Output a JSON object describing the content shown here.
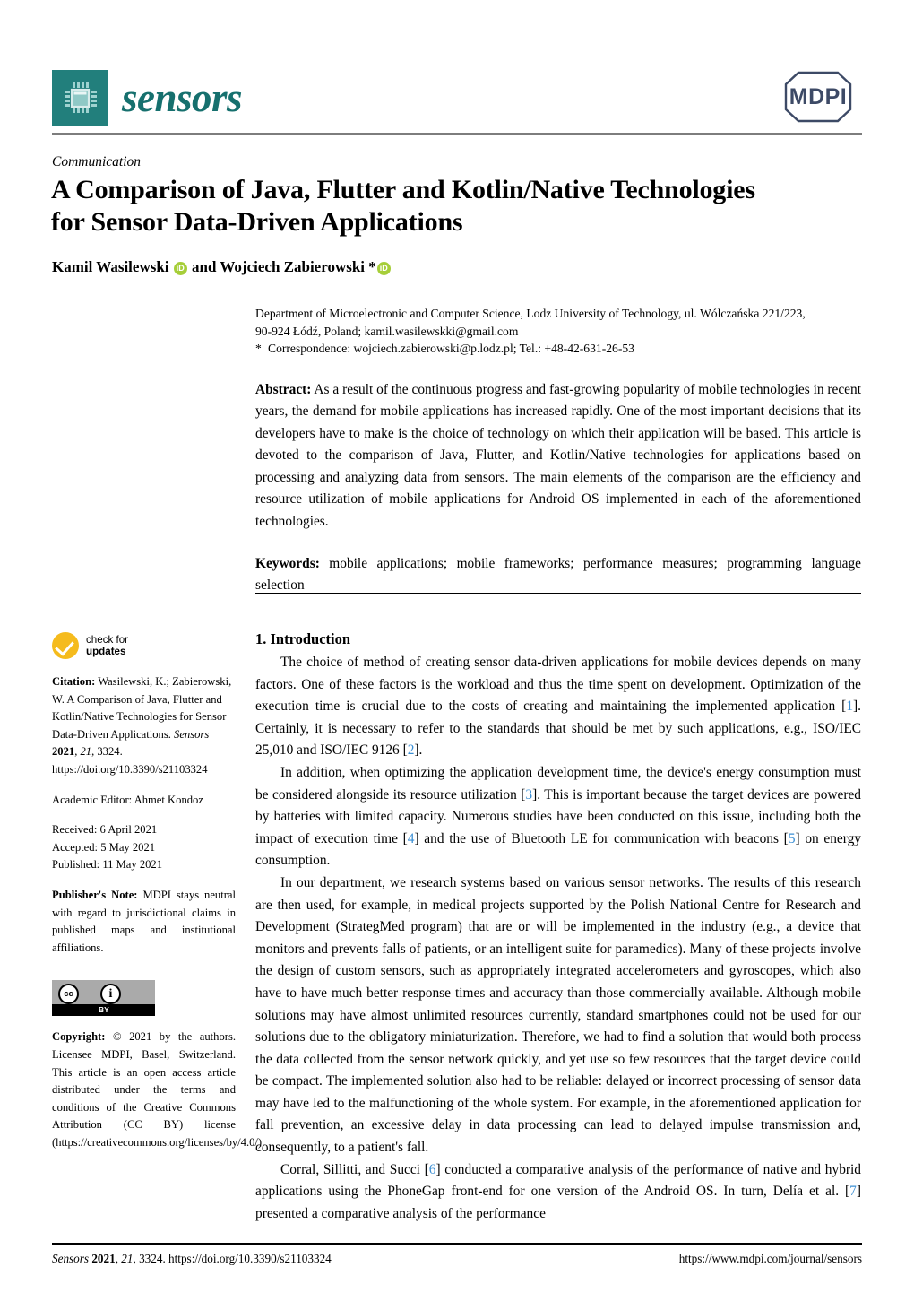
{
  "header": {
    "journal_name": "sensors",
    "logo_icon": "microchip-icon",
    "publisher_logo_text": "MDPI",
    "logo_bg_color": "#227f7c",
    "journal_text_color": "#16706e",
    "mdpi_color": "#3d4a66"
  },
  "article": {
    "type_label": "Communication",
    "title_line1": "A Comparison of Java, Flutter and Kotlin/Native Technologies",
    "title_line2": "for Sensor Data-Driven Applications",
    "author_pre": "Kamil Wasilewski",
    "author_mid": " and Wojciech Zabierowski *",
    "orcid_glyph": "iD",
    "orcid_color": "#a6ce39"
  },
  "affiliation": {
    "line1": "Department of Microelectronic and Computer Science, Lodz University of Technology, ul. Wólczańska 221/223,",
    "line2": "90-924 Łódź, Poland; kamil.wasilewskki@gmail.com",
    "star": "*",
    "correspondence": "Correspondence: wojciech.zabierowski@p.lodz.pl; Tel.: +48-42-631-26-53"
  },
  "abstract": {
    "label": "Abstract:",
    "text": " As a result of the continuous progress and fast-growing popularity of mobile technologies in recent years, the demand for mobile applications has increased rapidly. One of the most important decisions that its developers have to make is the choice of technology on which their application will be based. This article is devoted to the comparison of Java, Flutter, and Kotlin/Native technologies for applications based on processing and analyzing data from sensors. The main elements of the comparison are the efficiency and resource utilization of mobile applications for Android OS implemented in each of the aforementioned technologies."
  },
  "keywords": {
    "label": "Keywords:",
    "text": " mobile applications; mobile frameworks; performance measures; programming language selection"
  },
  "sidebar": {
    "check_for_updates": {
      "line1": "check for",
      "line2": "updates"
    },
    "citation": {
      "label": "Citation:",
      "text_pre": " Wasilewski, K.; Zabierowski, W. A Comparison of Java, Flutter and Kotlin/Native Technologies for Sensor Data-Driven Applications. ",
      "journal": "Sensors",
      "year": "2021",
      "volume": "21",
      "article_no": "3324",
      "doi": "https://doi.org/10.3390/s21103324"
    },
    "academic_editor": "Academic Editor: Ahmet Kondoz",
    "received": "Received: 6 April 2021",
    "accepted": "Accepted: 5 May 2021",
    "published": "Published: 11 May 2021",
    "publisher_note": {
      "label": "Publisher's Note:",
      "text": " MDPI stays neutral with regard to jurisdictional claims in published maps and institutional affiliations."
    },
    "license_badge": {
      "cc": "cc",
      "by": "BY",
      "person": "i"
    },
    "copyright": {
      "label": "Copyright:",
      "text": " © 2021 by the authors. Licensee MDPI, Basel, Switzerland. This article is an open access article distributed under the terms and conditions of the Creative Commons Attribution (CC BY) license (https://creativecommons.org/licenses/by/4.0/)."
    }
  },
  "main": {
    "section_title": "1. Introduction",
    "citation_color": "#3b8fd4",
    "paragraphs": [
      {
        "parts": [
          {
            "t": "The choice of method of creating sensor data-driven applications for mobile devices depends on many factors. One of these factors is the workload and thus the time spent on development. Optimization of the execution time is crucial due to the costs of creating and maintaining the implemented application ["
          },
          {
            "t": "1",
            "cite": true
          },
          {
            "t": "]. Certainly, it is necessary to refer to the standards that should be met by such applications, e.g., ISO/IEC 25,010 and ISO/IEC 9126 ["
          },
          {
            "t": "2",
            "cite": true
          },
          {
            "t": "]."
          }
        ]
      },
      {
        "parts": [
          {
            "t": "In addition, when optimizing the application development time, the device's energy consumption must be considered alongside its resource utilization ["
          },
          {
            "t": "3",
            "cite": true
          },
          {
            "t": "]. This is important because the target devices are powered by batteries with limited capacity. Numerous studies have been conducted on this issue, including both the impact of execution time ["
          },
          {
            "t": "4",
            "cite": true
          },
          {
            "t": "] and the use of Bluetooth LE for communication with beacons ["
          },
          {
            "t": "5",
            "cite": true
          },
          {
            "t": "] on energy consumption."
          }
        ]
      },
      {
        "parts": [
          {
            "t": "In our department, we research systems based on various sensor networks. The results of this research are then used, for example, in medical projects supported by the Polish National Centre for Research and Development (StrategMed program) that are or will be implemented in the industry (e.g., a device that monitors and prevents falls of patients, or an intelligent suite for paramedics). Many of these projects involve the design of custom sensors, such as appropriately integrated accelerometers and gyroscopes, which also have to have much better response times and accuracy than those commercially available. Although mobile solutions may have almost unlimited resources currently, standard smartphones could not be used for our solutions due to the obligatory miniaturization. Therefore, we had to find a solution that would both process the data collected from the sensor network quickly, and yet use so few resources that the target device could be compact. The implemented solution also had to be reliable: delayed or incorrect processing of sensor data may have led to the malfunctioning of the whole system. For example, in the aforementioned application for fall prevention, an excessive delay in data processing can lead to delayed impulse transmission and, consequently, to a patient's fall."
          }
        ]
      },
      {
        "parts": [
          {
            "t": "Corral, Sillitti, and Succi ["
          },
          {
            "t": "6",
            "cite": true
          },
          {
            "t": "] conducted a comparative analysis of the performance of native and hybrid applications using the PhoneGap front-end for one version of the Android OS. In turn, Delía et al. ["
          },
          {
            "t": "7",
            "cite": true
          },
          {
            "t": "] presented a comparative analysis of the performance"
          }
        ]
      }
    ]
  },
  "footer": {
    "journal": "Sensors",
    "year": "2021",
    "volume": "21",
    "article_no": "3324.",
    "doi": "https://doi.org/10.3390/s21103324",
    "url": "https://www.mdpi.com/journal/sensors"
  }
}
